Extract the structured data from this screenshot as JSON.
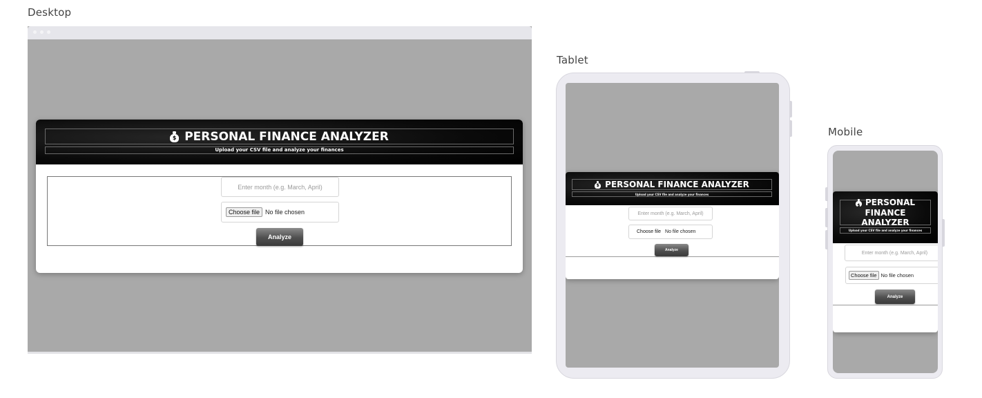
{
  "frames": {
    "desktop_label": "Desktop",
    "tablet_label": "Tablet",
    "mobile_label": "Mobile"
  },
  "app": {
    "icon": "money-bag-icon",
    "icon_glyph": "$",
    "title": "PERSONAL FINANCE ANALYZER",
    "mobile_title_line1": "PERSONAL",
    "mobile_title_line2": "FINANCE ANALYZER",
    "subtitle": "Upload your CSV file and analyze your finances",
    "month_placeholder": "Enter month (e.g. March, April)",
    "file_button_label": "Choose file",
    "file_status": "No file chosen",
    "analyze_label": "Analyze"
  },
  "colors": {
    "page_background": "#a9a9a9",
    "header_background": "#000000",
    "analyze_button": "#4f4f4f",
    "device_frame": "#ecebf1"
  }
}
